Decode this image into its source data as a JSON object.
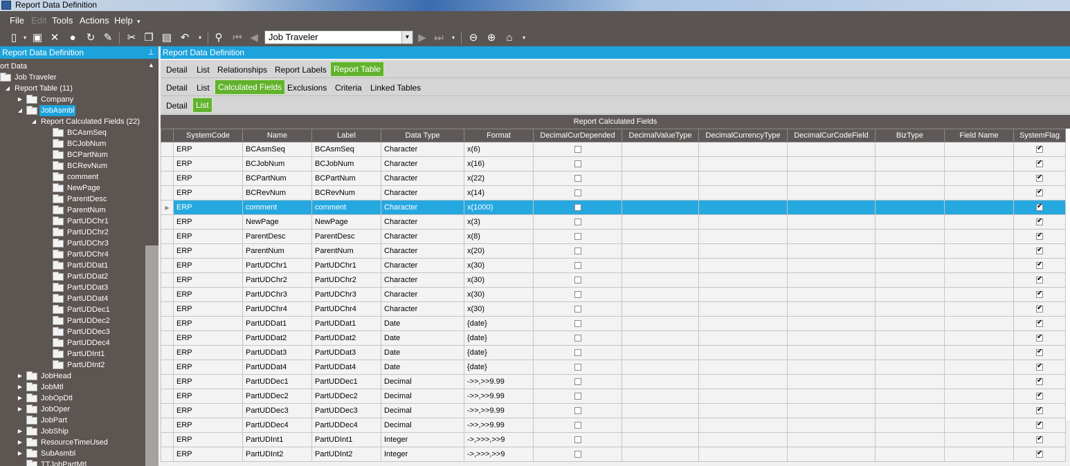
{
  "window": {
    "title": "Report Data Definition"
  },
  "menu": [
    "File",
    "Edit",
    "Tools",
    "Actions",
    "Help"
  ],
  "toolbar": {
    "record": "Job Traveler"
  },
  "left": {
    "header": "Report Data Definition",
    "tree": [
      {
        "label": "ort Data"
      },
      {
        "label": "Job Traveler"
      },
      {
        "label": "Report Table (11)"
      },
      {
        "label": "Company"
      },
      {
        "label": "JobAsmbl"
      },
      {
        "label": "Report Calculated Fields (22)"
      },
      {
        "label": "BCAsmSeq"
      },
      {
        "label": "BCJobNum"
      },
      {
        "label": "BCPartNum"
      },
      {
        "label": "BCRevNum"
      },
      {
        "label": "comment"
      },
      {
        "label": "NewPage"
      },
      {
        "label": "ParentDesc"
      },
      {
        "label": "ParentNum"
      },
      {
        "label": "PartUDChr1"
      },
      {
        "label": "PartUDChr2"
      },
      {
        "label": "PartUDChr3"
      },
      {
        "label": "PartUDChr4"
      },
      {
        "label": "PartUDDat1"
      },
      {
        "label": "PartUDDat2"
      },
      {
        "label": "PartUDDat3"
      },
      {
        "label": "PartUDDat4"
      },
      {
        "label": "PartUDDec1"
      },
      {
        "label": "PartUDDec2"
      },
      {
        "label": "PartUDDec3"
      },
      {
        "label": "PartUDDec4"
      },
      {
        "label": "PartUDInt1"
      },
      {
        "label": "PartUDInt2"
      },
      {
        "label": "JobHead"
      },
      {
        "label": "JobMtl"
      },
      {
        "label": "JobOpDtl"
      },
      {
        "label": "JobOper"
      },
      {
        "label": "JobPart"
      },
      {
        "label": "JobShip"
      },
      {
        "label": "ResourceTimeUsed"
      },
      {
        "label": "SubAsmbl"
      },
      {
        "label": "TTJobPartMtl"
      }
    ]
  },
  "right": {
    "header": "Report Data Definition",
    "tabs1": [
      "Detail",
      "List",
      "Relationships",
      "Report Labels",
      "Report Table"
    ],
    "tabs2": [
      "Detail",
      "List",
      "Calculated Fields",
      "Exclusions",
      "Criteria",
      "Linked Tables"
    ],
    "tabs3": [
      "Detail",
      "List"
    ],
    "grid": {
      "caption": "Report Calculated Fields",
      "columns": [
        "SystemCode",
        "Name",
        "Label",
        "Data Type",
        "Format",
        "DecimalCurDepended",
        "DecimalValueType",
        "DecimalCurrencyType",
        "DecimalCurCodeField",
        "BizType",
        "Field Name",
        "SystemFlag"
      ],
      "rows": [
        [
          "ERP",
          "BCAsmSeq",
          "BCAsmSeq",
          "Character",
          "x(6)"
        ],
        [
          "ERP",
          "BCJobNum",
          "BCJobNum",
          "Character",
          "x(16)"
        ],
        [
          "ERP",
          "BCPartNum",
          "BCPartNum",
          "Character",
          "x(22)"
        ],
        [
          "ERP",
          "BCRevNum",
          "BCRevNum",
          "Character",
          "x(14)"
        ],
        [
          "ERP",
          "comment",
          "comment",
          "Character",
          "x(1000)"
        ],
        [
          "ERP",
          "NewPage",
          "NewPage",
          "Character",
          "x(3)"
        ],
        [
          "ERP",
          "ParentDesc",
          "ParentDesc",
          "Character",
          "x(8)"
        ],
        [
          "ERP",
          "ParentNum",
          "ParentNum",
          "Character",
          "x(20)"
        ],
        [
          "ERP",
          "PartUDChr1",
          "PartUDChr1",
          "Character",
          "x(30)"
        ],
        [
          "ERP",
          "PartUDChr2",
          "PartUDChr2",
          "Character",
          "x(30)"
        ],
        [
          "ERP",
          "PartUDChr3",
          "PartUDChr3",
          "Character",
          "x(30)"
        ],
        [
          "ERP",
          "PartUDChr4",
          "PartUDChr4",
          "Character",
          "x(30)"
        ],
        [
          "ERP",
          "PartUDDat1",
          "PartUDDat1",
          "Date",
          "{date}"
        ],
        [
          "ERP",
          "PartUDDat2",
          "PartUDDat2",
          "Date",
          "{date}"
        ],
        [
          "ERP",
          "PartUDDat3",
          "PartUDDat3",
          "Date",
          "{date}"
        ],
        [
          "ERP",
          "PartUDDat4",
          "PartUDDat4",
          "Date",
          "{date}"
        ],
        [
          "ERP",
          "PartUDDec1",
          "PartUDDec1",
          "Decimal",
          "->>,>>9.99"
        ],
        [
          "ERP",
          "PartUDDec2",
          "PartUDDec2",
          "Decimal",
          "->>,>>9.99"
        ],
        [
          "ERP",
          "PartUDDec3",
          "PartUDDec3",
          "Decimal",
          "->>,>>9.99"
        ],
        [
          "ERP",
          "PartUDDec4",
          "PartUDDec4",
          "Decimal",
          "->>,>>9.99"
        ],
        [
          "ERP",
          "PartUDInt1",
          "PartUDInt1",
          "Integer",
          "->,>>>,>>9"
        ],
        [
          "ERP",
          "PartUDInt2",
          "PartUDInt2",
          "Integer",
          "->,>>>,>>9"
        ]
      ]
    }
  }
}
